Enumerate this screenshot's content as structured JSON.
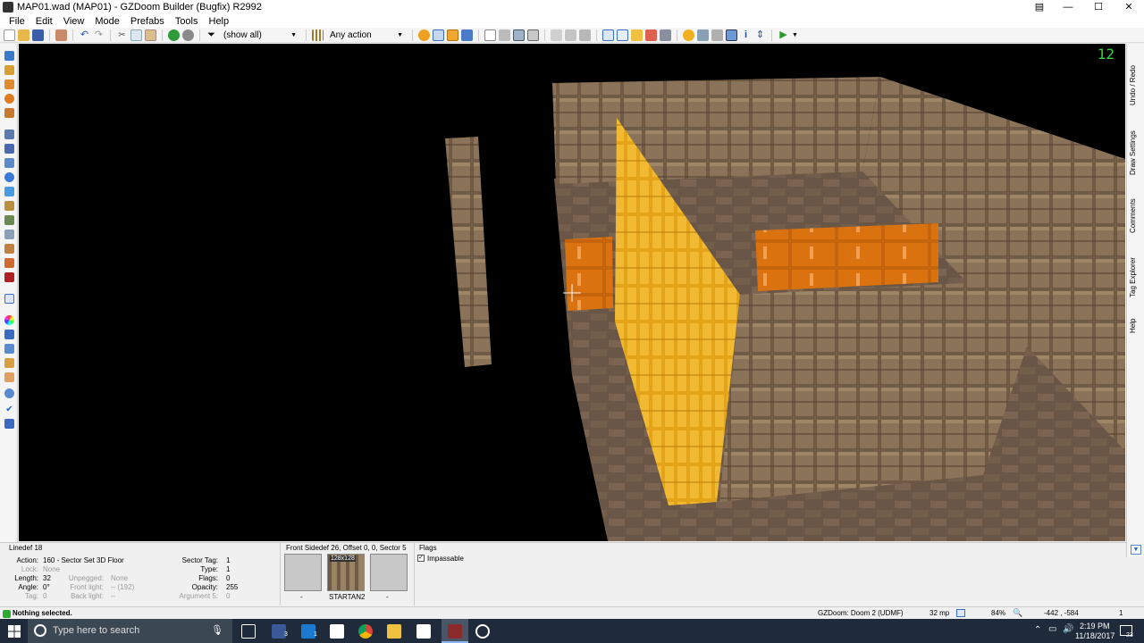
{
  "window": {
    "title": "MAP01.wad (MAP01) - GZDoom Builder (Bugfix) R2992",
    "minimize": "—",
    "maximize": "☐",
    "close": "✕"
  },
  "menu": [
    "File",
    "Edit",
    "View",
    "Mode",
    "Prefabs",
    "Tools",
    "Help"
  ],
  "toolbar": {
    "filter_label": "(show all)",
    "action_label": "Any action"
  },
  "viewport": {
    "fps": "12"
  },
  "right_tabs": [
    "Undo / Redo",
    "Draw Settings",
    "Comments",
    "Tag Explorer",
    "Help"
  ],
  "info": {
    "header": "Linedef 18",
    "left": [
      {
        "label": "Action:",
        "value": "160 - Sector Set 3D Floor",
        "dim": false
      },
      {
        "label": "Lock:",
        "value": "None",
        "dim": true
      },
      {
        "label": "Length:",
        "value": "32",
        "dim": false
      },
      {
        "label": "Angle:",
        "value": "0°",
        "dim": false
      },
      {
        "label": "Tag:",
        "value": "0",
        "dim": true
      }
    ],
    "mid": [
      {
        "label": "Unpegged:",
        "value": "None",
        "dim": true
      },
      {
        "label": "Front light:",
        "value": "-- (192)",
        "dim": true
      },
      {
        "label": "Back light:",
        "value": "--",
        "dim": true
      }
    ],
    "args": [
      {
        "label": "Sector Tag:",
        "value": "1",
        "dim": false
      },
      {
        "label": "Type:",
        "value": "1",
        "dim": false
      },
      {
        "label": "Flags:",
        "value": "0",
        "dim": false
      },
      {
        "label": "Opacity:",
        "value": "255",
        "dim": false
      },
      {
        "label": "Argument 5:",
        "value": "0",
        "dim": true
      }
    ],
    "sidedef_title": "Front Sidedef 26, Offset 0, 0, Sector 5",
    "textures": [
      {
        "name": "-",
        "badge": ""
      },
      {
        "name": "STARTAN2",
        "badge": "128x128"
      },
      {
        "name": "-",
        "badge": ""
      }
    ],
    "flags_title": "Flags",
    "flags": [
      {
        "label": "Impassable",
        "checked": true
      }
    ]
  },
  "status": {
    "message": "Nothing selected.",
    "game_config": "GZDoom: Doom 2 (UDMF)",
    "grid": "32 mp",
    "zoom": "84%",
    "coords": "-442 , -584",
    "counter": "1"
  },
  "taskbar": {
    "search_placeholder": "Type here to search",
    "time": "2:19 PM",
    "date": "11/18/2017",
    "badge_mail": "3",
    "badge_notify": "1",
    "notif_count": "23"
  }
}
